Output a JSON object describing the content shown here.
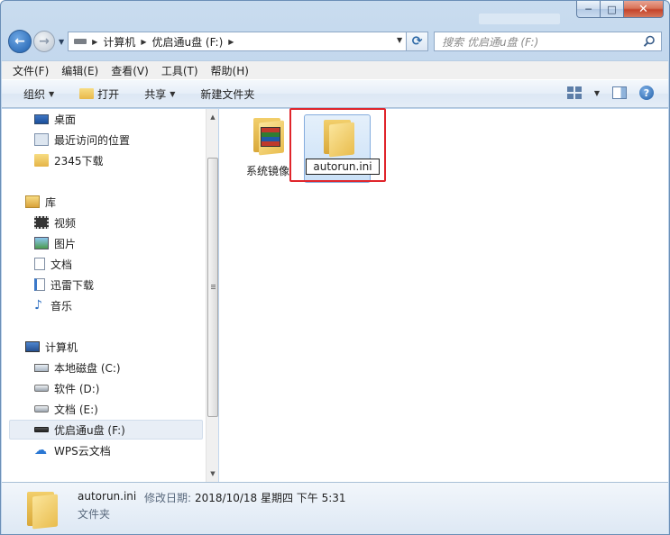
{
  "window": {
    "caption_min": "─",
    "caption_max": "□",
    "caption_close": "✕"
  },
  "address_bar": {
    "crumbs": [
      "计算机",
      "优启通u盘 (F:)"
    ],
    "search_placeholder": "搜索 优启通u盘 (F:)"
  },
  "menu": [
    "文件(F)",
    "编辑(E)",
    "查看(V)",
    "工具(T)",
    "帮助(H)"
  ],
  "toolbar": {
    "organize": "组织",
    "open": "打开",
    "share": "共享",
    "new_folder": "新建文件夹",
    "help": "?"
  },
  "nav_pane": {
    "favorites": [
      {
        "label": "桌面",
        "icon": "desktop-icon"
      },
      {
        "label": "最近访问的位置",
        "icon": "recent-places-icon"
      },
      {
        "label": "2345下载",
        "icon": "folder-icon"
      }
    ],
    "libraries_label": "库",
    "libraries": [
      {
        "label": "视频",
        "icon": "video-icon"
      },
      {
        "label": "图片",
        "icon": "pictures-icon"
      },
      {
        "label": "文档",
        "icon": "documents-icon"
      },
      {
        "label": "迅雷下载",
        "icon": "download-icon"
      },
      {
        "label": "音乐",
        "icon": "music-icon"
      }
    ],
    "computer_label": "计算机",
    "drives": [
      {
        "label": "本地磁盘 (C:)",
        "icon": "os-disk-icon"
      },
      {
        "label": "软件 (D:)",
        "icon": "disk-icon"
      },
      {
        "label": "文档 (E:)",
        "icon": "disk-icon"
      },
      {
        "label": "优启通u盘 (F:)",
        "icon": "usb-drive-icon",
        "selected": true
      }
    ],
    "wps_label": "WPS云文档"
  },
  "files": [
    {
      "name": "系统镜像",
      "icon": "winrar-folder-icon"
    },
    {
      "name": "autorun.ini",
      "icon": "folder-icon",
      "selected": true,
      "renaming": true
    }
  ],
  "details": {
    "name": "autorun.ini",
    "modified_label": "修改日期:",
    "modified_value": "2018/10/18 星期四 下午 5:31",
    "type": "文件夹"
  },
  "colors": {
    "highlight_box": "#e0252b",
    "selection": "#c9e0f7"
  }
}
